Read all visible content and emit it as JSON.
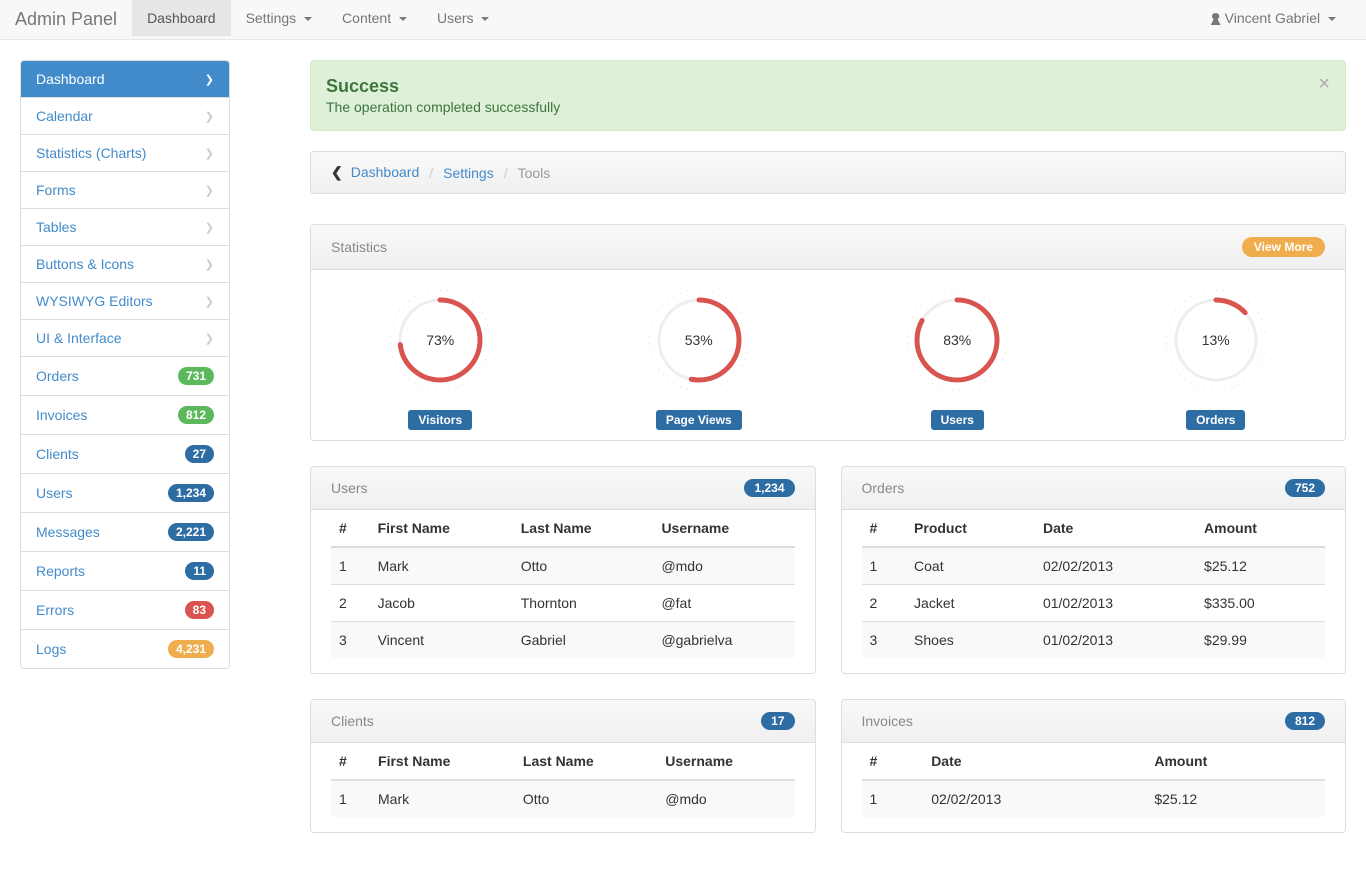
{
  "navbar": {
    "brand": "Admin Panel",
    "items": [
      {
        "label": "Dashboard",
        "active": true,
        "dropdown": false
      },
      {
        "label": "Settings",
        "active": false,
        "dropdown": true
      },
      {
        "label": "Content",
        "active": false,
        "dropdown": true
      },
      {
        "label": "Users",
        "active": false,
        "dropdown": true
      }
    ],
    "user": "Vincent Gabriel"
  },
  "sidebar": [
    {
      "label": "Dashboard",
      "kind": "chevron",
      "active": true
    },
    {
      "label": "Calendar",
      "kind": "chevron"
    },
    {
      "label": "Statistics (Charts)",
      "kind": "chevron"
    },
    {
      "label": "Forms",
      "kind": "chevron"
    },
    {
      "label": "Tables",
      "kind": "chevron"
    },
    {
      "label": "Buttons & Icons",
      "kind": "chevron"
    },
    {
      "label": "WYSIWYG Editors",
      "kind": "chevron"
    },
    {
      "label": "UI & Interface",
      "kind": "chevron"
    },
    {
      "label": "Orders",
      "kind": "badge",
      "badge": "731",
      "color": "green"
    },
    {
      "label": "Invoices",
      "kind": "badge",
      "badge": "812",
      "color": "green"
    },
    {
      "label": "Clients",
      "kind": "badge",
      "badge": "27",
      "color": "darkblue"
    },
    {
      "label": "Users",
      "kind": "badge",
      "badge": "1,234",
      "color": "darkblue"
    },
    {
      "label": "Messages",
      "kind": "badge",
      "badge": "2,221",
      "color": "darkblue"
    },
    {
      "label": "Reports",
      "kind": "badge",
      "badge": "11",
      "color": "darkblue"
    },
    {
      "label": "Errors",
      "kind": "badge",
      "badge": "83",
      "color": "red"
    },
    {
      "label": "Logs",
      "kind": "badge",
      "badge": "4,231",
      "color": "orange"
    }
  ],
  "alert": {
    "title": "Success",
    "message": "The operation completed successfully"
  },
  "breadcrumb": [
    {
      "label": "Dashboard",
      "active": false
    },
    {
      "label": "Settings",
      "active": false
    },
    {
      "label": "Tools",
      "active": true
    }
  ],
  "statistics_panel": {
    "title": "Statistics",
    "view_more": "View More"
  },
  "chart_data": {
    "type": "bar",
    "categories": [
      "Visitors",
      "Page Views",
      "Users",
      "Orders"
    ],
    "values": [
      73,
      53,
      83,
      13
    ],
    "ylim": [
      0,
      100
    ],
    "title": "Statistics",
    "xlabel": "",
    "ylabel": "%"
  },
  "users_panel": {
    "title": "Users",
    "badge": "1,234",
    "columns": [
      "#",
      "First Name",
      "Last Name",
      "Username"
    ],
    "rows": [
      [
        "1",
        "Mark",
        "Otto",
        "@mdo"
      ],
      [
        "2",
        "Jacob",
        "Thornton",
        "@fat"
      ],
      [
        "3",
        "Vincent",
        "Gabriel",
        "@gabrielva"
      ]
    ]
  },
  "orders_panel": {
    "title": "Orders",
    "badge": "752",
    "columns": [
      "#",
      "Product",
      "Date",
      "Amount"
    ],
    "rows": [
      [
        "1",
        "Coat",
        "02/02/2013",
        "$25.12"
      ],
      [
        "2",
        "Jacket",
        "01/02/2013",
        "$335.00"
      ],
      [
        "3",
        "Shoes",
        "01/02/2013",
        "$29.99"
      ]
    ]
  },
  "clients_panel": {
    "title": "Clients",
    "badge": "17",
    "columns": [
      "#",
      "First Name",
      "Last Name",
      "Username"
    ],
    "rows": [
      [
        "1",
        "Mark",
        "Otto",
        "@mdo"
      ]
    ]
  },
  "invoices_panel": {
    "title": "Invoices",
    "badge": "812",
    "columns": [
      "#",
      "Date",
      "Amount"
    ],
    "rows": [
      [
        "1",
        "02/02/2013",
        "$25.12"
      ]
    ]
  }
}
